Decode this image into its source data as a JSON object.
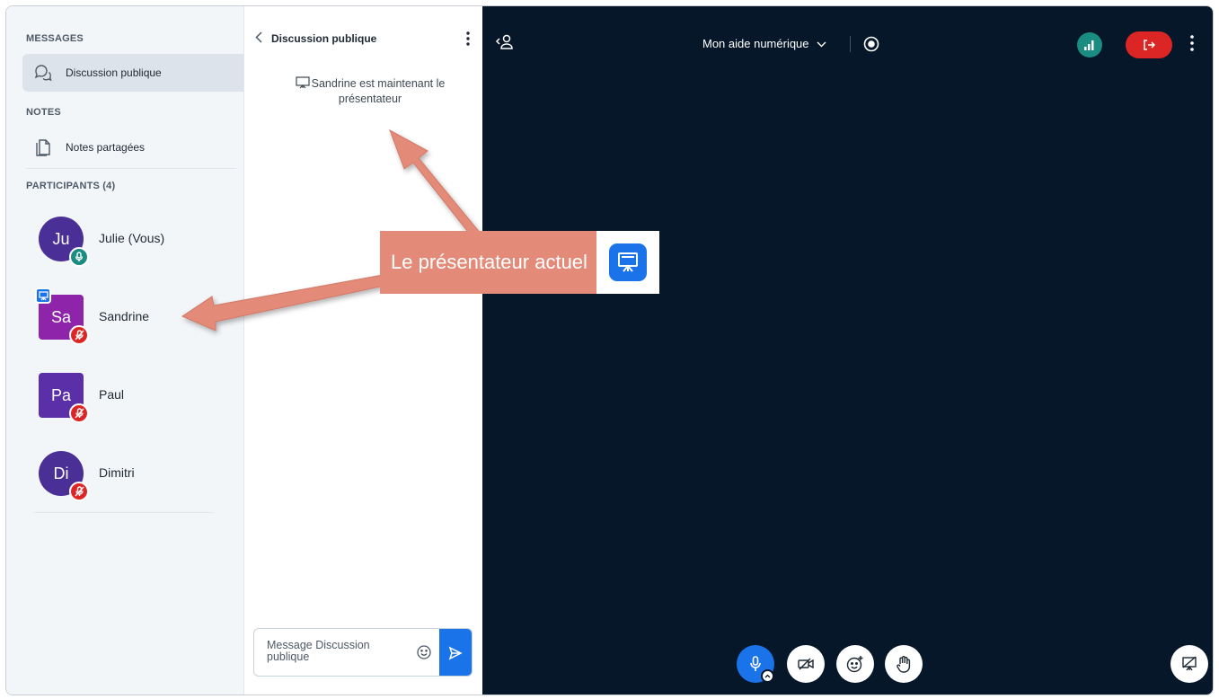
{
  "sidebar": {
    "messages_heading": "MESSAGES",
    "public_chat_label": "Discussion publique",
    "notes_heading": "NOTES",
    "shared_notes_label": "Notes partagées",
    "participants_heading": "PARTICIPANTS (4)",
    "participants": [
      {
        "initials": "Ju",
        "name": "Julie (Vous)",
        "avatar_color": "#4a2f97",
        "shape": "round",
        "mic": "on",
        "presenter": false
      },
      {
        "initials": "Sa",
        "name": "Sandrine",
        "avatar_color": "#8e24aa",
        "shape": "square",
        "mic": "muted",
        "presenter": true
      },
      {
        "initials": "Pa",
        "name": "Paul",
        "avatar_color": "#5b2fa8",
        "shape": "square",
        "mic": "muted",
        "presenter": false
      },
      {
        "initials": "Di",
        "name": "Dimitri",
        "avatar_color": "#4a2f97",
        "shape": "round",
        "mic": "muted",
        "presenter": false
      }
    ]
  },
  "chat": {
    "title": "Discussion publique",
    "system_message": "Sandrine est maintenant le présentateur",
    "composer_placeholder": "Message Discussion publique"
  },
  "stage": {
    "meeting_title": "Mon aide numérique",
    "background_color": "#06172a"
  },
  "annotation": {
    "callout_text": "Le présentateur actuel",
    "callout_color": "#e48a79"
  },
  "colors": {
    "accent": "#1a73e8",
    "leave": "#dc2626",
    "connection": "#1b8c82",
    "mic_on": "#1b8c82",
    "mic_muted": "#dc2626"
  }
}
